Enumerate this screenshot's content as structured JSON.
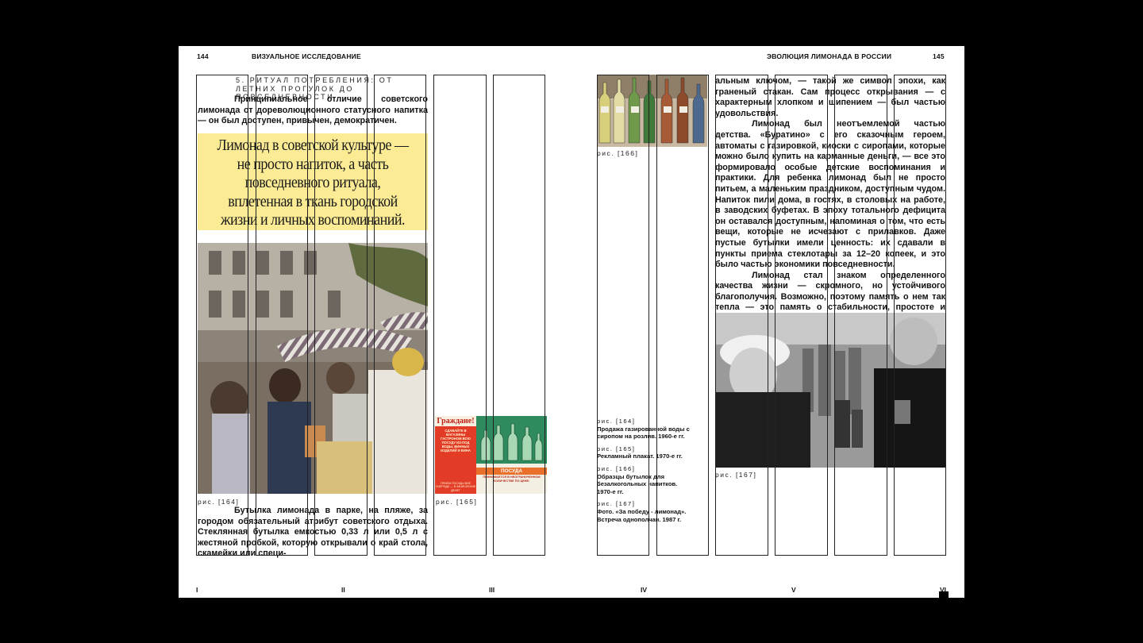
{
  "header": {
    "left_page": "144",
    "left_title": "ВИЗУАЛЬНОЕ ИССЛЕДОВАНИЕ",
    "right_title": "ЭВОЛЮЦИЯ ЛИМОНАДА В РОССИИ",
    "right_page": "145"
  },
  "section": {
    "title": "5. РИТУАЛ ПОТРЕБЛЕНИЯ: ОТ ЛЕТНИХ ПРОГУЛОК ДО ПОВСЕДНЕВНОСТИ",
    "intro": "Принципиальное отличие советского лимонада от дореволюционного статусного напитка — он был доступен, привычен, демократичен."
  },
  "quote": "Лимонад в советской культуре — не просто напиток, а часть повседневного ритуала, вплетенная в ткань городской жизни и личных воспоминаний.",
  "left_body": "Бутылка лимонада в парке, на пляже, за городом обязательный атрибут советского отдыха. Стеклянная бутылка емкостью 0,33 л или 0,5 л с жестяной пробкой, которую открывали о край стола, скамейки или специ-",
  "right_body": {
    "p1": "альным ключом, — такой же символ эпохи, как граненый стакан. Сам процесс открывания — с характерным хлопком и шипением — был частью удовольствия.",
    "p2": "Лимонад был неотъемлемой частью детства. «Буратино» с его сказочным героем, автоматы с газировкой, киоски с сиропами, которые можно было купить на карманные деньги, — все это формировало особые детские воспоминания и практики. Для ребенка лимонад был не просто питьем, а маленьким праздником, доступным чудом. Напиток пили дома, в гостях, в столовых на работе, в заводских буфетах. В эпоху тотального дефицита он оставался доступным, напоминая о том, что есть вещи, которые не исчезают с прилавков. Даже пустые бутылки имели ценность: их сдавали в пункты приема стеклотары за 12–20 копеек, и это было частью экономики повседневности.",
    "p3": "Лимонад стал знаком определенного качества жизни — скромного, но устойчивого благополучия. Возможно, поэтому память о нем так тепла — это память о стабильности, простоте и маленьких радостях, которые были у всех."
  },
  "figures": {
    "f164": "рис. [164]",
    "f165": "рис. [165]",
    "f166": "рис. [166]",
    "f167": "рис. [167]"
  },
  "poster": {
    "headline": "Граждане!",
    "left_text": "СДАВАЙТЕ В МАГАЗИНЫ ГАСТРОНОМ ВСЮ ПОСУДУ ИЗ-ПОД ВОДЫ, ВИННЫХ ИЗДЕЛИЙ И ВИНА",
    "bottom_left": "ПРИЕМ ПОСУДЫ ВНЕ ОЧЕРЕДИ — В ЗАЧИСЛЕНИЕ ДЕНЕГ",
    "right_label": "ПОСУДА",
    "right_sub": "ПРИНИМАЕТСЯ В НЕОГРАНИЧЕННОМ КОЛИЧЕСТВЕ ПО ЦЕНЕ:"
  },
  "captions": [
    {
      "num": "рис. [164]",
      "text": "Продажа газированной воды с сиропом на розлив. 1960-е гг."
    },
    {
      "num": "рис. [165]",
      "text": "Рекламный плакат. 1970-е гг."
    },
    {
      "num": "рис. [166]",
      "text": "Образцы бутылок для безалкогольных напитков. 1970-е гг."
    },
    {
      "num": "рис. [167]",
      "text": "Фото. «За победу - лимонад». Встреча однополчан. 1987 г."
    }
  ],
  "footer": {
    "c1": "I",
    "c2": "II",
    "c3": "III",
    "c4": "IV",
    "c5": "V",
    "c6": "VI"
  }
}
